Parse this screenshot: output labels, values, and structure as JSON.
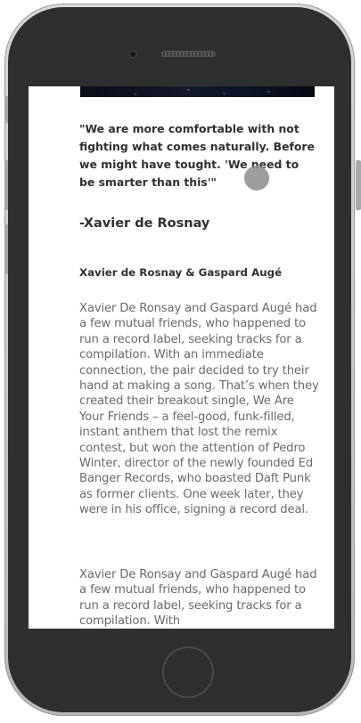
{
  "device": {
    "type": "phone mockup"
  },
  "article": {
    "quote": "\"We are more comfortable with not fighting what comes naturally. Before we might have tought. 'We need to be smarter than this'\"",
    "quote_author": "-Xavier de Rosnay",
    "section_heading": "Xavier de Rosnay & Gaspard Augé",
    "paragraphs": [
      "Xavier De Ronsay and Gaspard Augé had a few mutual friends, who happened to run a record label, seeking tracks for a compilation. With an immediate connection, the pair decided to try their hand at making a song. That’s when they created their breakout single, We Are Your Friends – a feel-good, funk-filled, instant anthem that lost the remix contest, but won the attention of Pedro Winter, director of the newly founded Ed Banger Records, who boasted Daft Punk as former clients. One week later, they were in his office, signing a record deal.",
      "Xavier De Ronsay and Gaspard Augé had a few mutual friends, who happened to run a record label, seeking tracks for a compilation. With"
    ]
  },
  "colors": {
    "phone_frame": "#2f2f2f",
    "phone_bezel": "#c8c8c8",
    "heading_text": "#303030",
    "body_text": "#6a6a6a",
    "screen_bg": "#ffffff"
  }
}
